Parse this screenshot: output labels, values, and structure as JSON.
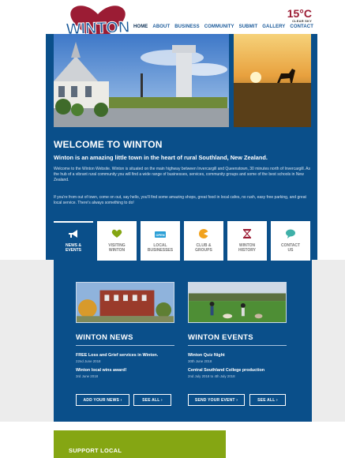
{
  "header": {
    "logo_text": "WINTON",
    "weather": {
      "temp": "15°C",
      "condition": "CLEAR SKY"
    },
    "nav": [
      "HOME",
      "ABOUT",
      "BUSINESS",
      "COMMUNITY",
      "SUBMIT",
      "GALLERY",
      "CONTACT"
    ]
  },
  "welcome": {
    "title": "WELCOME TO WINTON",
    "subtitle": "Winton is an amazing little town in the heart of rural Southland, New Zealand.",
    "p1": "Welcome to the Winton Website. Winton is situated on the main highway between Invercargill and Queenstown, 30 minutes north of Invercargill. As the hub of a vibrant rural community you will find a wide range of businesses, services, community groups and some of the best schools in New Zealand.",
    "p2": "If you're from out of town, come on out, say hello, you'll find some amazing shops, great food in local cafes, no rush, easy free parking, and great local service. There's always something to do!"
  },
  "cards": [
    {
      "label1": "NEWS &",
      "label2": "EVENTS",
      "icon": "megaphone-icon",
      "color": "#ffffff"
    },
    {
      "label1": "VISITING",
      "label2": "WINTON",
      "icon": "heart-icon",
      "color": "#85a613"
    },
    {
      "label1": "LOCAL",
      "label2": "BUSINESSES",
      "icon": "open-sign-icon",
      "color": "#2b9fd6"
    },
    {
      "label1": "CLUB &",
      "label2": "GROUPS",
      "icon": "club-icon",
      "color": "#f2a21d"
    },
    {
      "label1": "WINTON",
      "label2": "HISTORY",
      "icon": "hourglass-icon",
      "color": "#9b1c34"
    },
    {
      "label1": "CONTACT",
      "label2": "US",
      "icon": "chat-icon",
      "color": "#3fb0a8"
    }
  ],
  "news": {
    "title": "WINTON NEWS",
    "items": [
      {
        "title": "FREE Loss and Grief services in Winton.",
        "date": "22nd June 2018"
      },
      {
        "title": "Winton local wins award!",
        "date": "3rd June 2018"
      }
    ],
    "add_button": "ADD YOUR NEWS ›",
    "see_all": "SEE ALL ›"
  },
  "events": {
    "title": "WINTON EVENTS",
    "items": [
      {
        "title": "Winton Quiz Night",
        "date": "30th June 2018"
      },
      {
        "title": "Central Southland College production",
        "date": "2nd July 2018 to 4th July 2018"
      }
    ],
    "send_button": "SEND YOUR EVENT ›",
    "see_all": "SEE ALL ›"
  },
  "support": {
    "title": "SUPPORT LOCAL"
  }
}
